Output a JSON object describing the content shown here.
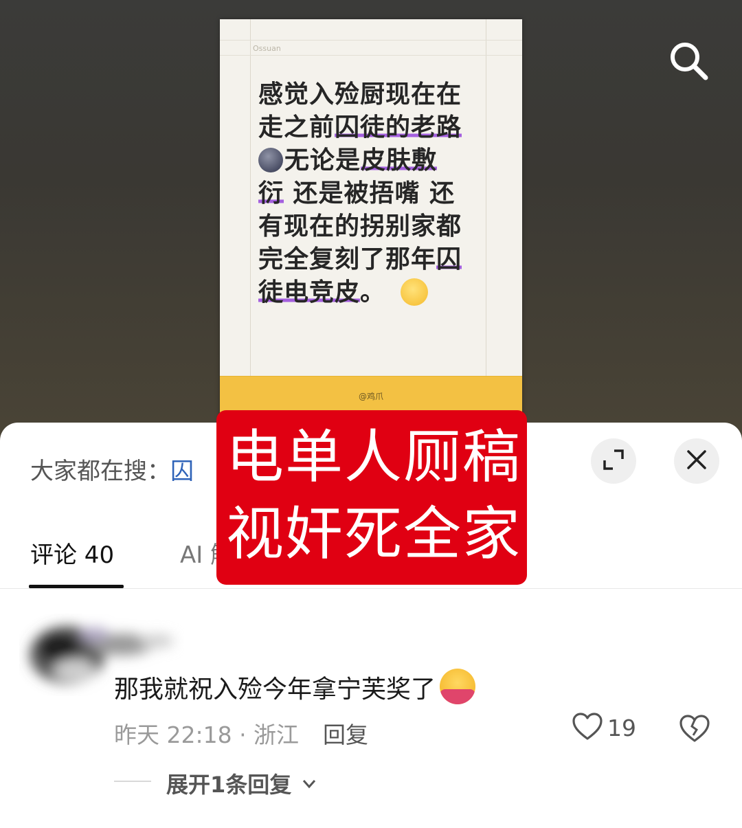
{
  "video": {
    "note_header_small": "Ossuan",
    "note_lines": [
      {
        "parts": [
          {
            "t": "感觉入殓厨现在在",
            "hl": false
          }
        ]
      },
      {
        "parts": [
          {
            "t": "走之前",
            "hl": false
          },
          {
            "t": "囚徒的老路",
            "hl": true
          }
        ]
      },
      {
        "parts": [
          {
            "t": "无论是",
            "hl": false
          },
          {
            "t": "皮肤敷",
            "hl": true
          }
        ],
        "moon_emoji": true
      },
      {
        "parts": [
          {
            "t": "衍",
            "hl": true
          },
          {
            "t": " 还是被捂嘴 还",
            "hl": false
          }
        ]
      },
      {
        "parts": [
          {
            "t": "有现在的拐别家都",
            "hl": false
          }
        ]
      },
      {
        "parts": [
          {
            "t": "完全复刻了那年",
            "hl": false
          },
          {
            "t": "囚",
            "hl": true
          }
        ]
      },
      {
        "parts": [
          {
            "t": "徒电竞皮",
            "hl": true
          },
          {
            "t": "。",
            "hl": false
          }
        ],
        "pleading_emoji": true
      }
    ],
    "note_footer_tag": "@鸡爪",
    "search_icon": "search-icon"
  },
  "sheet": {
    "hot_search_prefix": "大家都在搜：",
    "hot_search_keyword": "囚",
    "expand_icon": "expand-icon",
    "close_icon": "close-icon",
    "tabs": [
      {
        "label": "评论 40",
        "active": true
      },
      {
        "label": "AI 解",
        "active": false
      }
    ]
  },
  "comment": {
    "text": "那我就祝入殓今年拿宁芙奖了",
    "emoji": "hugging-face-emoji",
    "time_location": "昨天 22:18 · 浙江",
    "reply_label": "回复",
    "like_count": "19",
    "expand_replies": "展开1条回复"
  },
  "overlay": {
    "line1": "电单人厕稿",
    "line2": "视奸死全家"
  },
  "colors": {
    "overlay_red": "#e00012",
    "highlight_purple": "#9646dc",
    "keyword_blue": "#2f63b8",
    "note_footer_yellow": "#f3c143"
  }
}
